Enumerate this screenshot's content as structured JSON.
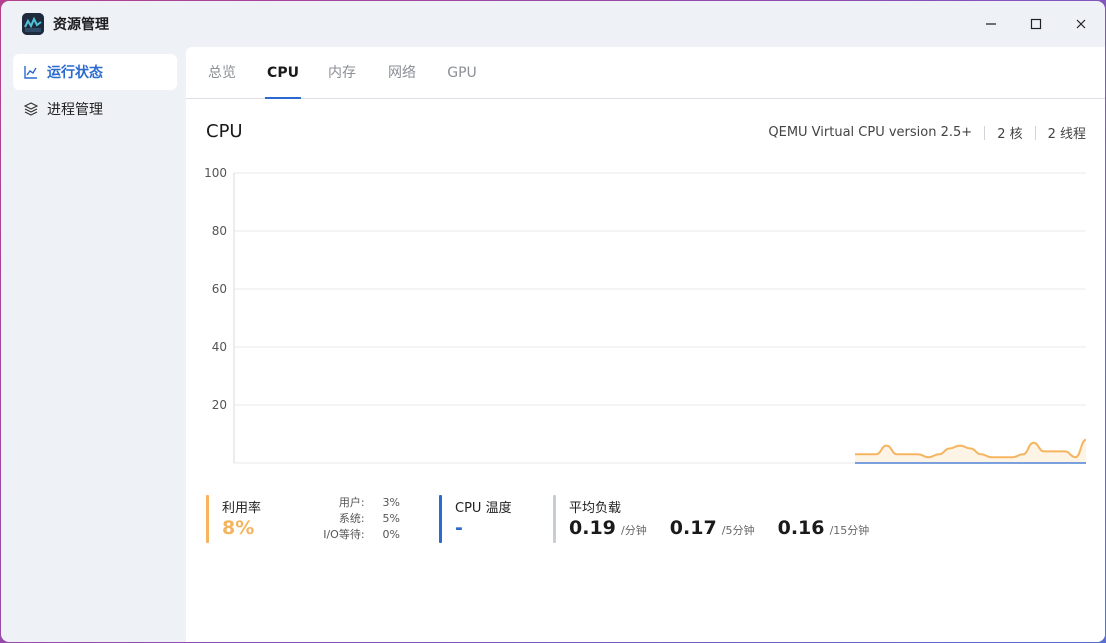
{
  "app": {
    "title": "资源管理"
  },
  "sidebar": {
    "items": [
      {
        "label": "运行状态",
        "icon": "line-chart-icon",
        "active": true
      },
      {
        "label": "进程管理",
        "icon": "layers-icon",
        "active": false
      }
    ]
  },
  "tabs": [
    {
      "label": "总览",
      "active": false
    },
    {
      "label": "CPU",
      "active": true
    },
    {
      "label": "内存",
      "active": false
    },
    {
      "label": "网络",
      "active": false
    },
    {
      "label": "GPU",
      "active": false
    }
  ],
  "cpu": {
    "title": "CPU",
    "model": "QEMU Virtual CPU version 2.5+",
    "cores": "2 核",
    "threads": "2 线程"
  },
  "chart_data": {
    "type": "area",
    "ylim": [
      0,
      100
    ],
    "yticks": [
      "100",
      "80",
      "60",
      "40",
      "20"
    ],
    "series": [
      {
        "values": [
          3,
          3,
          3,
          6,
          3,
          3,
          3,
          2,
          3,
          5,
          6,
          5,
          3,
          2,
          2,
          2,
          3,
          7,
          4,
          4,
          4,
          2,
          8
        ],
        "color": "#f5b560"
      }
    ]
  },
  "stats": {
    "usage": {
      "label": "利用率",
      "value": "8%",
      "user_label": "用户:",
      "user_value": "3%",
      "system_label": "系统:",
      "system_value": "5%",
      "io_label": "I/O等待:",
      "io_value": "0%"
    },
    "temp": {
      "label": "CPU 温度",
      "value": "-"
    },
    "load": {
      "label": "平均负载",
      "v1": "0.19",
      "u1": "/分钟",
      "v5": "0.17",
      "u5": "/5分钟",
      "v15": "0.16",
      "u15": "/15分钟"
    }
  },
  "colors": {
    "accent": "#2b6bd0",
    "usage": "#f5b560",
    "temp": "#2b6bd0",
    "load": "#c8ccd3"
  }
}
